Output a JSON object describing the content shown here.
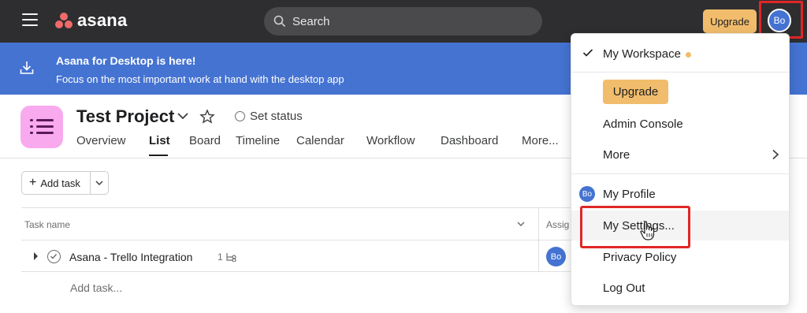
{
  "topbar": {
    "logo_text": "asana",
    "search_placeholder": "Search",
    "upgrade_label": "Upgrade",
    "avatar_initials": "Bo"
  },
  "banner": {
    "title": "Asana for Desktop is here!",
    "subtitle": "Focus on the most important work at hand with the desktop app"
  },
  "project": {
    "title": "Test Project",
    "status_label": "Set status",
    "tabs": [
      "Overview",
      "List",
      "Board",
      "Timeline",
      "Calendar",
      "Workflow",
      "Dashboard",
      "More..."
    ],
    "active_tab": "List"
  },
  "toolbar": {
    "add_task_label": "Add task"
  },
  "table": {
    "columns": [
      "Task name",
      "Assig"
    ],
    "rows": [
      {
        "name": "Asana - Trello Integration",
        "subtasks": "1",
        "assignee": "Bo"
      }
    ],
    "add_task_placeholder": "Add task..."
  },
  "menu": {
    "workspace": "My Workspace",
    "upgrade": "Upgrade",
    "admin_console": "Admin Console",
    "more": "More",
    "my_profile": "My Profile",
    "my_profile_avatar": "Bo",
    "my_settings": "My Settings...",
    "privacy_policy": "Privacy Policy",
    "log_out": "Log Out"
  },
  "colors": {
    "topbar": "#2e2e30",
    "banner": "#4573d2",
    "upgrade": "#f1bd6c",
    "highlight": "#e02626",
    "logo_coral": "#f06a6a",
    "project_icon": "#f9aaef"
  }
}
